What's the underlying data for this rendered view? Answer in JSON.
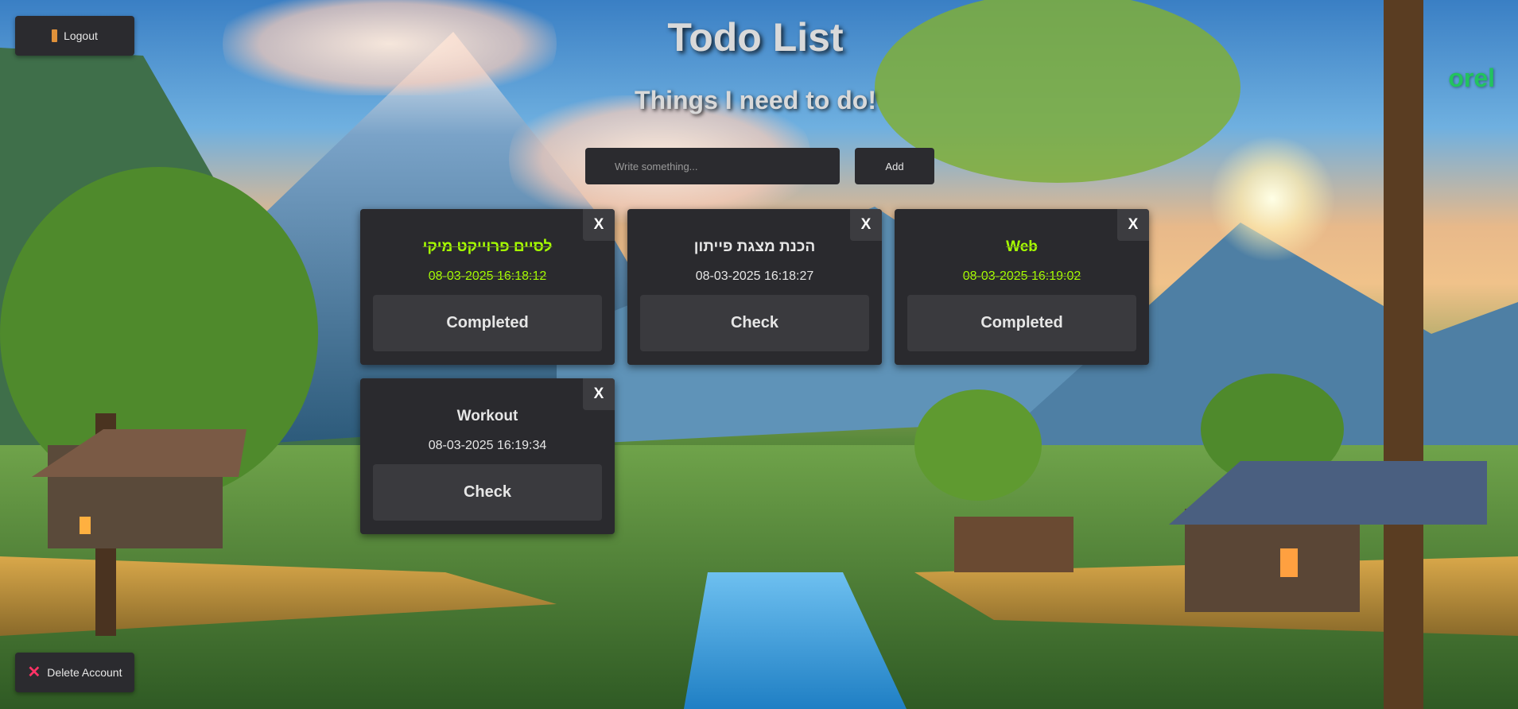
{
  "header": {
    "title": "Todo List",
    "subtitle": "Things I need to do!",
    "username": "orel"
  },
  "controls": {
    "logout_label": "Logout",
    "logout_icon": "door-icon",
    "delete_account_label": "Delete Account",
    "delete_account_icon": "close-icon",
    "delete_icon_color": "#ff3366"
  },
  "new_todo": {
    "placeholder": "Write something...",
    "value": "",
    "add_label": "Add"
  },
  "todos": [
    {
      "title": "לסיים פרוייקט מיקי",
      "date": "08-03-2025 16:18:12",
      "completed": true,
      "action_label": "Completed",
      "close_label": "X"
    },
    {
      "title": "הכנת מצגת פייתון",
      "date": "08-03-2025 16:18:27",
      "completed": false,
      "action_label": "Check",
      "close_label": "X"
    },
    {
      "title": "Web",
      "date": "08-03-2025 16:19:02",
      "completed": true,
      "action_label": "Completed",
      "close_label": "X"
    },
    {
      "title": "Workout",
      "date": "08-03-2025 16:19:34",
      "completed": false,
      "action_label": "Check",
      "close_label": "X"
    }
  ],
  "colors": {
    "completed_text": "#a6ff00",
    "username": "#22c35e",
    "card_bg": "#2a2a2e"
  }
}
